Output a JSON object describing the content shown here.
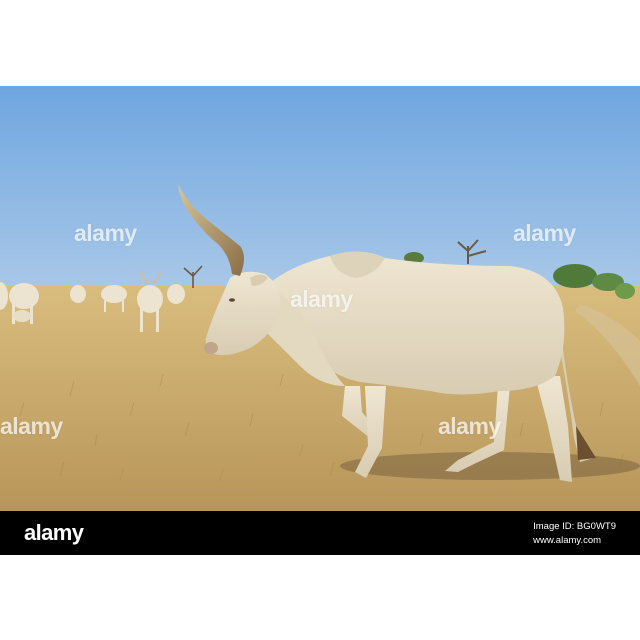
{
  "watermark_text": "alamy",
  "footer": {
    "logo_text": "alamy",
    "image_id": "Image ID: BG0WT9",
    "website": "www.alamy.com"
  },
  "colors": {
    "sky_top": "#6fa6e0",
    "sky_bottom": "#a9c8e8",
    "grass": "#c9a968",
    "cow_body": "#e6dcc6",
    "footer_bg": "#000000"
  }
}
